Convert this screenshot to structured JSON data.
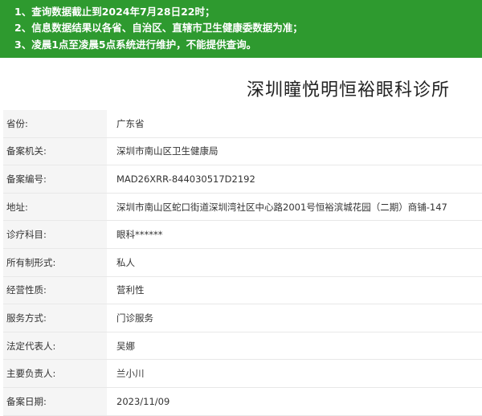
{
  "notice": {
    "line1": "1、查询数据截止到2024年7月28日22时；",
    "line2": "2、信息数据结果以各省、自治区、直辖市卫生健康委数据为准；",
    "line3": "3、凌晨1点至凌晨5点系统进行维护，不能提供查询。"
  },
  "page_title": "深圳瞳悦明恒裕眼科诊所",
  "rows": [
    {
      "label": "省份:",
      "value": "广东省"
    },
    {
      "label": "备案机关:",
      "value": "深圳市南山区卫生健康局"
    },
    {
      "label": "备案编号:",
      "value": "MAD26XRR-844030517D2192"
    },
    {
      "label": "地址:",
      "value": "深圳市南山区蛇口街道深圳湾社区中心路2001号恒裕滨城花园（二期）商铺-147"
    },
    {
      "label": "诊疗科目:",
      "value": "眼科******"
    },
    {
      "label": "所有制形式:",
      "value": "私人"
    },
    {
      "label": "经营性质:",
      "value": "营利性"
    },
    {
      "label": "服务方式:",
      "value": "门诊服务"
    },
    {
      "label": "法定代表人:",
      "value": "吴娜"
    },
    {
      "label": "主要负责人:",
      "value": "兰小川"
    },
    {
      "label": "备案日期:",
      "value": "2023/11/09"
    }
  ],
  "colors": {
    "banner": "#2e9a2f",
    "label_bg": "#f5f5f5"
  }
}
